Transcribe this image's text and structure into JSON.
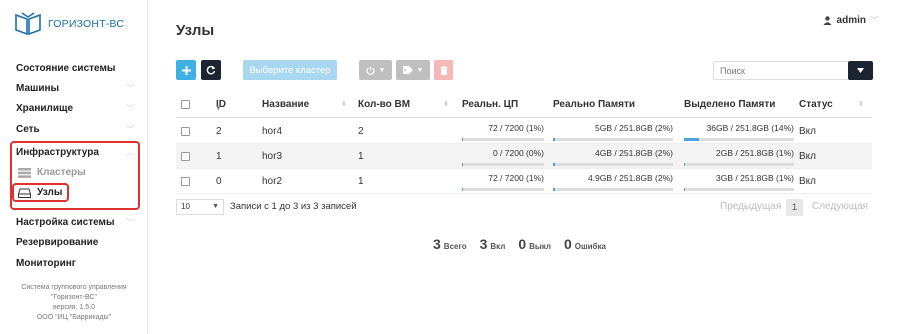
{
  "brand": {
    "name": "ГОРИЗОНТ-ВС",
    "color": "#1a6fa8"
  },
  "user": {
    "name": "admin"
  },
  "page": {
    "title": "Узлы"
  },
  "sidebar": {
    "items": [
      {
        "label": "Состояние системы"
      },
      {
        "label": "Машины"
      },
      {
        "label": "Хранилище"
      },
      {
        "label": "Сеть"
      },
      {
        "label": "Инфраструктура"
      },
      {
        "label": "Кластеры"
      },
      {
        "label": "Узлы"
      },
      {
        "label": "Настройка системы"
      },
      {
        "label": "Резервирование"
      },
      {
        "label": "Мониторинг"
      }
    ],
    "footer": {
      "line1": "Система группового управления",
      "line2": "\"Горизонт-ВС\"",
      "line3": "версия: 1.5.0",
      "line4": "ООО \"ИЦ \"Баррикады\""
    }
  },
  "toolbar": {
    "add_icon": "plus-icon",
    "refresh_icon": "refresh-icon",
    "cluster_label": "Выберите кластер",
    "power_icon": "power-icon",
    "tag_icon": "tag-icon",
    "delete_icon": "trash-icon",
    "accent": "#3fb0e4",
    "dark": "#1e2532"
  },
  "search": {
    "placeholder": "Поиск"
  },
  "table": {
    "columns": [
      "ID",
      "Название",
      "Кол-во ВМ",
      "Реальн. ЦП",
      "Реально Памяти",
      "Выделено Памяти",
      "Статус"
    ],
    "rows": [
      {
        "id": "2",
        "name": "hor4",
        "vms": "2",
        "cpu": "72 / 7200 (1%)",
        "cpu_pct": 1,
        "mem_real": "5GB / 251.8GB (2%)",
        "mem_real_pct": 2,
        "mem_alloc": "36GB / 251.8GB (14%)",
        "mem_alloc_pct": 14,
        "status": "Вкл"
      },
      {
        "id": "1",
        "name": "hor3",
        "vms": "1",
        "cpu": "0 / 7200 (0%)",
        "cpu_pct": 0,
        "mem_real": "4GB / 251.8GB (2%)",
        "mem_real_pct": 2,
        "mem_alloc": "2GB / 251.8GB (1%)",
        "mem_alloc_pct": 1,
        "status": "Вкл"
      },
      {
        "id": "0",
        "name": "hor2",
        "vms": "1",
        "cpu": "72 / 7200 (1%)",
        "cpu_pct": 1,
        "mem_real": "4.9GB / 251.8GB (2%)",
        "mem_real_pct": 2,
        "mem_alloc": "3GB / 251.8GB (1%)",
        "mem_alloc_pct": 1,
        "status": "Вкл"
      }
    ]
  },
  "pagination": {
    "page_size": "10",
    "info": "Записи с 1 до 3 из 3 записей",
    "prev": "Предыдущая",
    "current": "1",
    "next": "Следующая"
  },
  "stats": [
    {
      "num": "3",
      "label": "Всего"
    },
    {
      "num": "3",
      "label": "Вкл"
    },
    {
      "num": "0",
      "label": "Выкл"
    },
    {
      "num": "0",
      "label": "Ошибка"
    }
  ]
}
